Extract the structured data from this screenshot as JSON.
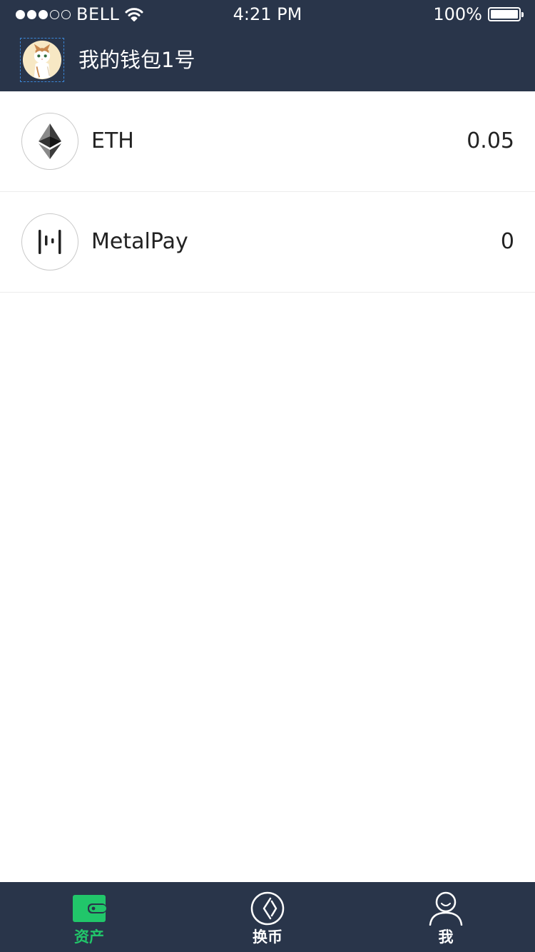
{
  "status_bar": {
    "carrier": "BELL",
    "time": "4:21 PM",
    "battery": "100%"
  },
  "header": {
    "wallet_name": "我的钱包1号"
  },
  "assets": [
    {
      "name": "ETH",
      "balance": "0.05",
      "icon": "ethereum-icon"
    },
    {
      "name": "MetalPay",
      "balance": "0",
      "icon": "metalpay-icon"
    }
  ],
  "tabs": [
    {
      "label": "资产",
      "icon": "wallet-icon",
      "active": true
    },
    {
      "label": "换币",
      "icon": "exchange-icon",
      "active": false
    },
    {
      "label": "我",
      "icon": "person-icon",
      "active": false
    }
  ],
  "colors": {
    "header_bg": "#29354a",
    "accent": "#21c66a",
    "divider": "#ececec"
  }
}
